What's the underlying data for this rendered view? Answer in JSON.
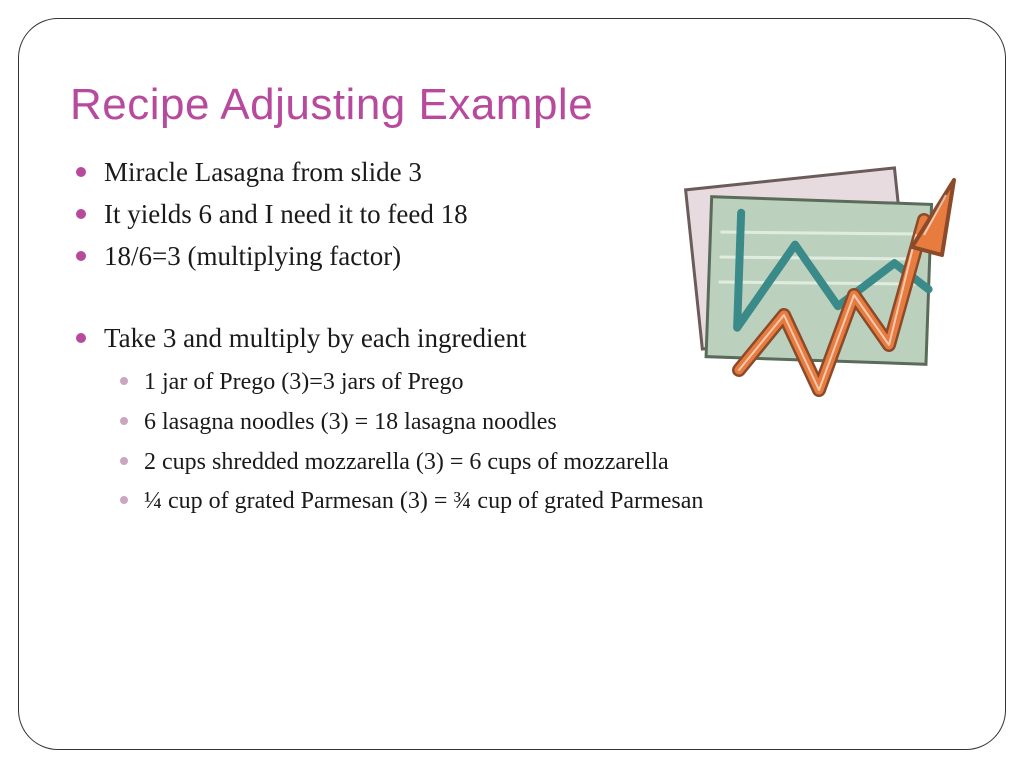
{
  "title": "Recipe Adjusting Example",
  "bullets": {
    "b1": "Miracle Lasagna from slide 3",
    "b2": "It yields 6 and I need it to feed 18",
    "b3": "18/6=3 (multiplying factor)",
    "b4": "Take 3 and multiply by each ingredient",
    "sub": {
      "s1": "1 jar of Prego (3)=3 jars of Prego",
      "s2": "6 lasagna noodles (3) = 18 lasagna noodles",
      "s3": "2 cups shredded mozzarella (3) = 6 cups of mozzarella",
      "s4": "¼ cup of grated Parmesan (3) = ¾ cup of grated Parmesan"
    }
  }
}
